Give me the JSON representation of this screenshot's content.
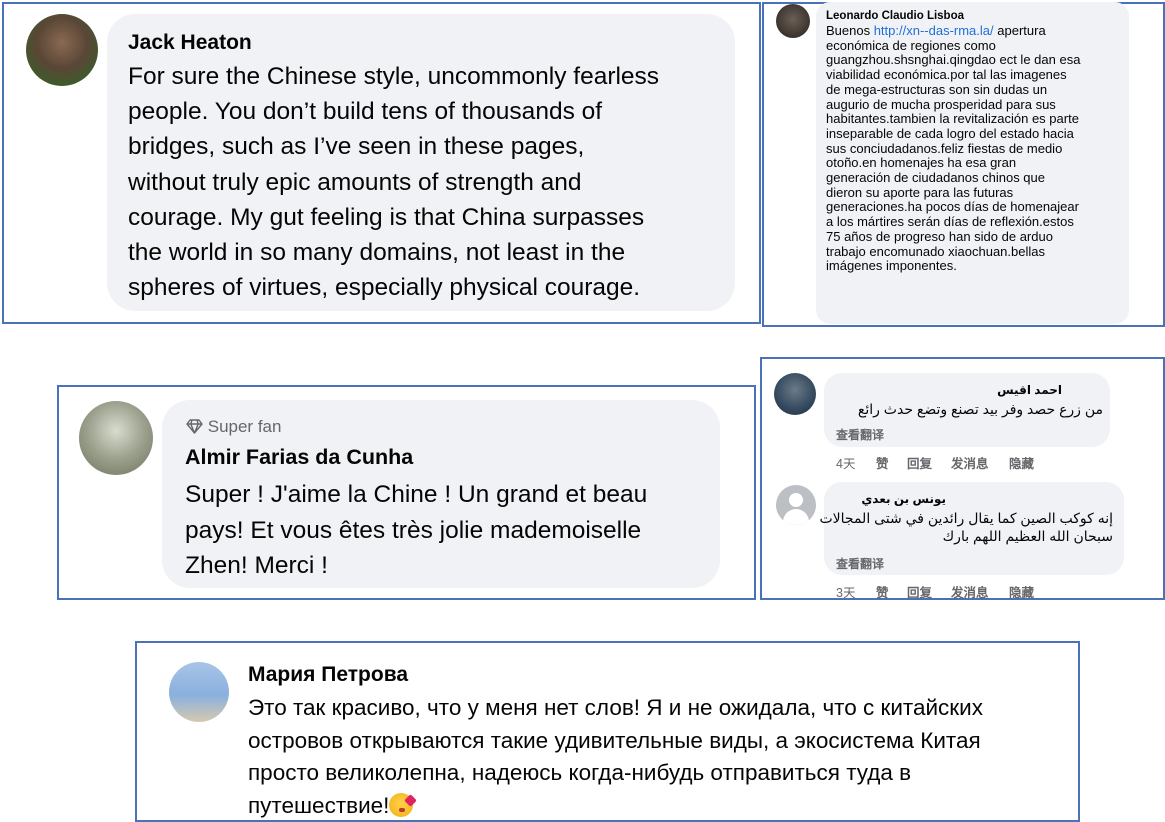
{
  "comments": {
    "jack": {
      "name": "Jack Heaton",
      "lines": [
        "For sure the Chinese style, uncommonly fearless",
        "people.  You don’t build tens of thousands of",
        "bridges, such as I’ve seen in these pages,",
        "without truly epic amounts of strength and",
        "courage. My gut feeling is that China surpasses",
        "the world in so many domains, not least in the",
        "spheres of virtues, especially physical courage."
      ]
    },
    "leonardo": {
      "name": "Leonardo Claudio Lisboa",
      "first_line_prefix": "Buenos ",
      "link": "http://xn--das-rma.la/",
      "first_line_suffix": " apertura",
      "lines": [
        "económica de regiones como",
        "guangzhou.shsnghai.qingdao ect le dan esa",
        "viabilidad económica.por tal las imagenes",
        "de mega-estructuras son sin dudas un",
        "augurio de mucha prosperidad para sus",
        "habitantes.tambien la revitalización es parte",
        "inseparable de cada logro del estado hacia",
        "sus conciudadanos.feliz fiestas de medio",
        "otoño.en homenajes ha esa gran",
        "generación de ciudadanos chinos que",
        "dieron su aporte para las futuras",
        "generaciones.ha pocos días de homenajear",
        "a los mártires serán días de reflexión.estos",
        "75 años de progreso han sido de arduo",
        "trabajo encomunado xiaochuan.bellas",
        "imágenes imponentes."
      ]
    },
    "almir": {
      "badge_icon": "diamond-icon",
      "badge": "Super fan",
      "name": "Almir Farias da Cunha",
      "lines": [
        "Super ! J'aime la Chine ! Un grand et beau",
        "pays! Et vous êtes très jolie mademoiselle",
        "Zhen! Merci !"
      ]
    },
    "arabic1": {
      "name": "احمد اقيس",
      "text": "من زرع حصد وفر بيد تصنع وتضع حدث رائع",
      "translate": "查看翻译",
      "meta": [
        "4天",
        "赞",
        "回复",
        "发消息",
        "隐藏"
      ]
    },
    "arabic2": {
      "name": "يونس بن بعدي",
      "lines": [
        "إنه كوكب الصين كما يقال رائدين في شتى المجالات",
        "سبحان الله العظيم اللهم بارك"
      ],
      "translate": "查看翻译",
      "meta": [
        "3天",
        "赞",
        "回复",
        "发消息",
        "隐藏"
      ]
    },
    "maria": {
      "name": "Мария Петрова",
      "lines": [
        "Это так красиво, что у меня нет слов! Я и не ожидала, что с китайских",
        "островов открываются такие удивительные виды, а экосистема Китая",
        "просто великолепна, надеюсь когда-нибудь отправиться туда в",
        "путешествие!"
      ],
      "emoji": "kissing-face-emoji"
    }
  },
  "colors": {
    "panel_border": "#4a72b8",
    "bubble_bg": "#f0f2f5",
    "link": "#216fdb",
    "secondary_text": "#65676b"
  }
}
